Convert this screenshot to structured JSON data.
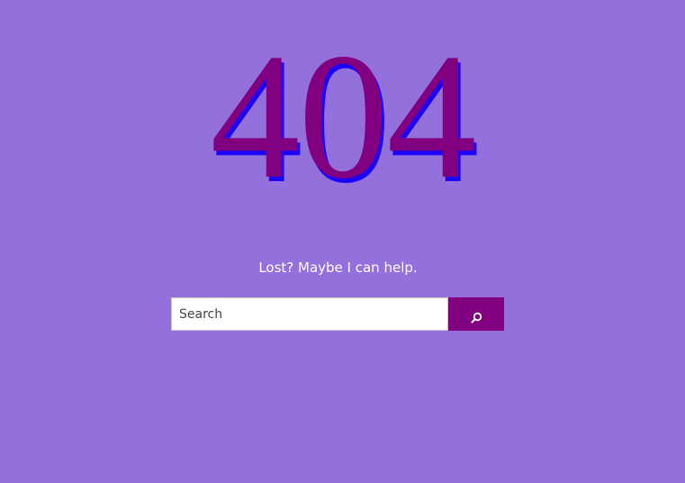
{
  "error": {
    "code": "404"
  },
  "message": {
    "text": "Lost? Maybe I can help."
  },
  "search": {
    "placeholder": "Search",
    "value": "",
    "button_icon": "search-icon"
  },
  "colors": {
    "background": "#9370DB",
    "code_fill": "#800080",
    "code_shadow": "#1A00FF",
    "button": "#800080",
    "text": "#FFFFFF"
  }
}
